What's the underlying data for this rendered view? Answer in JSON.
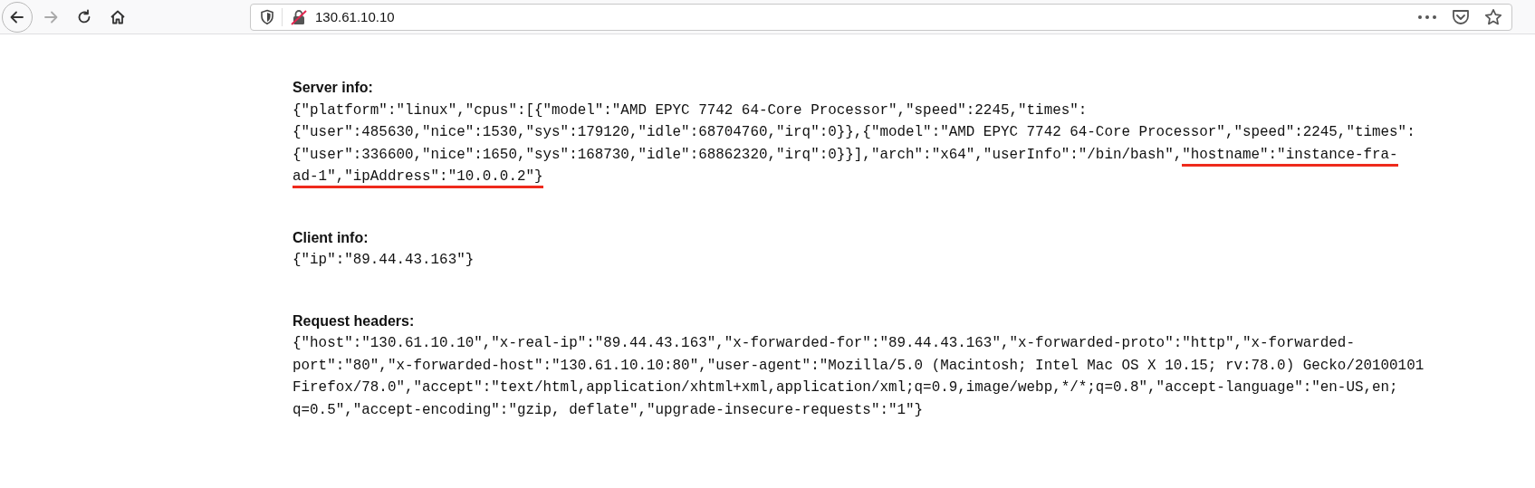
{
  "browser": {
    "url": "130.61.10.10"
  },
  "sections": [
    {
      "heading": "Server info:",
      "lines": [
        [
          {
            "text": "{\"platform\":\"linux\",\"cpus\":[{\"model\":\"AMD EPYC 7742 64-Core Processor\",\"speed\":2245,\"times\":",
            "marked": false
          }
        ],
        [
          {
            "text": "{\"user\":485630,\"nice\":1530,\"sys\":179120,\"idle\":68704760,\"irq\":0}},{\"model\":\"AMD EPYC 7742 64-Core Processor\",\"speed\":2245,\"times\":",
            "marked": false
          }
        ],
        [
          {
            "text": "{\"user\":336600,\"nice\":1650,\"sys\":168730,\"idle\":68862320,\"irq\":0}}],\"arch\":\"x64\",\"userInfo\":\"/bin/bash\",",
            "marked": false
          },
          {
            "text": "\"hostname\":\"instance-fra-",
            "marked": true
          }
        ],
        [
          {
            "text": "ad-1\",\"ipAddress\":\"10.0.0.2\"}",
            "marked": true
          }
        ]
      ]
    },
    {
      "heading": "Client info:",
      "lines": [
        [
          {
            "text": "{\"ip\":\"89.44.43.163\"}",
            "marked": false
          }
        ]
      ]
    },
    {
      "heading": "Request headers:",
      "lines": [
        [
          {
            "text": "{\"host\":\"130.61.10.10\",\"x-real-ip\":\"89.44.43.163\",\"x-forwarded-for\":\"89.44.43.163\",\"x-forwarded-proto\":\"http\",\"x-forwarded-",
            "marked": false
          }
        ],
        [
          {
            "text": "port\":\"80\",\"x-forwarded-host\":\"130.61.10.10:80\",\"user-agent\":\"Mozilla/5.0 (Macintosh; Intel Mac OS X 10.15; rv:78.0) Gecko/20100101",
            "marked": false
          }
        ],
        [
          {
            "text": "Firefox/78.0\",\"accept\":\"text/html,application/xhtml+xml,application/xml;q=0.9,image/webp,*/*;q=0.8\",\"accept-language\":\"en-US,en;",
            "marked": false
          }
        ],
        [
          {
            "text": "q=0.5\",\"accept-encoding\":\"gzip, deflate\",\"upgrade-insecure-requests\":\"1\"}",
            "marked": false
          }
        ]
      ]
    }
  ]
}
